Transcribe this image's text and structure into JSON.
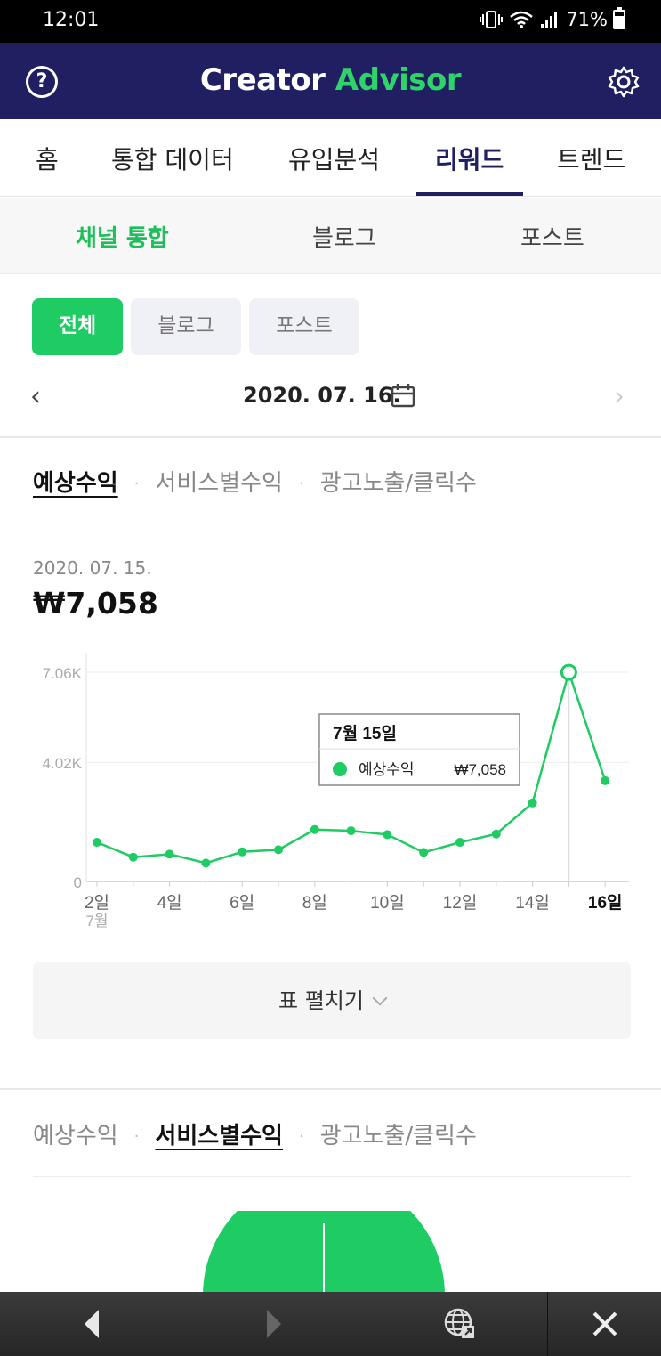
{
  "status_bar": {
    "time": "12:01",
    "battery": "71%"
  },
  "app": {
    "title_part1": "Creator",
    "title_part2": "Advisor",
    "help_glyph": "?"
  },
  "main_tabs": [
    {
      "label": "홈"
    },
    {
      "label": "통합 데이터"
    },
    {
      "label": "유입분석"
    },
    {
      "label": "리워드",
      "active": true
    },
    {
      "label": "트렌드"
    }
  ],
  "sub_tabs": [
    {
      "label": "채널 통합",
      "active": true
    },
    {
      "label": "블로그"
    },
    {
      "label": "포스트"
    }
  ],
  "chips": [
    {
      "label": "전체",
      "active": true
    },
    {
      "label": "블로그"
    },
    {
      "label": "포스트"
    }
  ],
  "date_nav": {
    "date": "2020. 07. 16.",
    "prev_glyph": "‹",
    "next_glyph": "›"
  },
  "metric_tabs_top": {
    "t1": "예상수익",
    "t2": "서비스별수익",
    "t3": "광고노출/클릭수",
    "sep": "·"
  },
  "selected_stat": {
    "date": "2020. 07. 15.",
    "value": "₩7,058"
  },
  "chart_data": {
    "type": "line",
    "x": [
      "2일",
      "3일",
      "4일",
      "5일",
      "6일",
      "7일",
      "8일",
      "9일",
      "10일",
      "11일",
      "12일",
      "13일",
      "14일",
      "15일",
      "16일"
    ],
    "tick_labels": [
      "2일",
      "4일",
      "6일",
      "8일",
      "10일",
      "12일",
      "14일",
      "16일"
    ],
    "x_sublabel": "7월",
    "y_ticks": [
      "0",
      "4.02K",
      "7.06K"
    ],
    "ylim": [
      0,
      7060
    ],
    "series": [
      {
        "name": "예상수익",
        "color": "#1fcc63",
        "values": [
          1320,
          820,
          920,
          620,
          1000,
          1070,
          1750,
          1710,
          1580,
          980,
          1320,
          1600,
          2650,
          7058,
          3400
        ]
      }
    ],
    "tooltip": {
      "title": "7월 15일",
      "series_label": "예상수익",
      "value": "₩7,058"
    },
    "highlight_index": 13,
    "grid": true
  },
  "expand_button": {
    "label": "표 펼치기"
  },
  "metric_tabs_bottom": {
    "t1": "예상수익",
    "t2": "서비스별수익",
    "t3": "광고노출/클릭수",
    "sep": "·"
  },
  "pie": {
    "color": "#1fcc63"
  },
  "bottom_bar": {
    "back_icon": "back-arrow-icon",
    "forward_icon": "forward-arrow-icon",
    "globe_icon": "globe-icon",
    "close_icon": "close-icon"
  }
}
